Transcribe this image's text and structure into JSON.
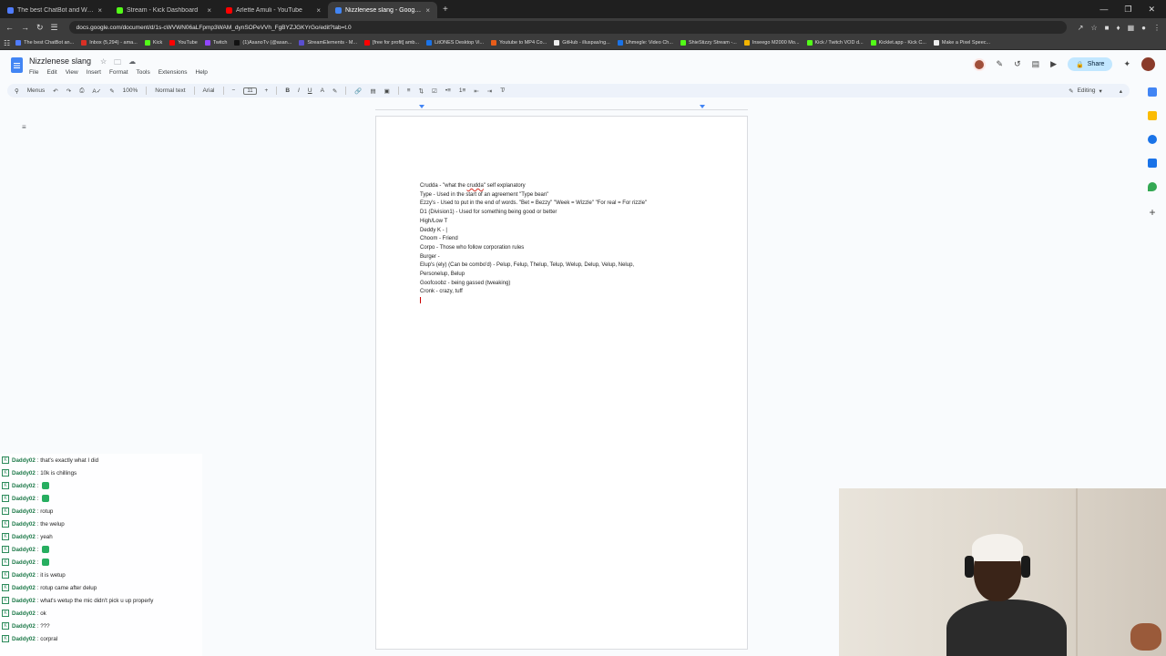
{
  "browser": {
    "tabs": [
      {
        "title": "The best ChatBot and Widgets for Ki",
        "color": "#4f7cff",
        "active": false
      },
      {
        "title": "Stream - Kick Dashboard",
        "color": "#53fc18",
        "active": false
      },
      {
        "title": "Arlette Amuli - YouTube",
        "color": "#ff0000",
        "active": false
      },
      {
        "title": "Nizzlenese slang - Google Docs",
        "color": "#4285f4",
        "active": true
      }
    ],
    "url": "docs.google.com/document/d/1s-cWVWN06aLFpmp3WAM_dynSOPeVVh_FgBYZJGKYrGo/edit?tab=t.0",
    "bookmarks": [
      {
        "label": "The best ChatBot an...",
        "color": "#4f7cff"
      },
      {
        "label": "Inbox (5,294) - ama...",
        "color": "#d93025"
      },
      {
        "label": "Kick",
        "color": "#53fc18"
      },
      {
        "label": "YouTube",
        "color": "#ff0000"
      },
      {
        "label": "Twitch",
        "color": "#9146ff"
      },
      {
        "label": "(1)AsanoTv (@asan...",
        "color": "#111111"
      },
      {
        "label": "StreamElements - M...",
        "color": "#5a4fcf"
      },
      {
        "label": "[free for profit] amb...",
        "color": "#ff0000"
      },
      {
        "label": "LitONES Desktop Vi...",
        "color": "#1a73e8"
      },
      {
        "label": "Youtube to MP4 Co...",
        "color": "#e85d1a"
      },
      {
        "label": "GitHub - illuspas/ng...",
        "color": "#eeeeee"
      },
      {
        "label": "Uhmegle: Video Ch...",
        "color": "#1a73e8"
      },
      {
        "label": "ShieStizzy Stream -...",
        "color": "#53fc18"
      },
      {
        "label": "Inseego M2000 Mo...",
        "color": "#f4b400"
      },
      {
        "label": "Kick / Twitch VOD d...",
        "color": "#53fc18"
      },
      {
        "label": "Kicklet.app - Kick C...",
        "color": "#53fc18"
      },
      {
        "label": "Make a Pixel Speec...",
        "color": "#eeeeee"
      }
    ]
  },
  "doc": {
    "title": "Nizzlenese slang",
    "menus": [
      "File",
      "Edit",
      "View",
      "Insert",
      "Format",
      "Tools",
      "Extensions",
      "Help"
    ],
    "share_label": "Share",
    "toolbar": {
      "menus_label": "Menus",
      "zoom": "100%",
      "style": "Normal text",
      "font": "Arial",
      "font_size": "11",
      "mode": "Editing"
    },
    "lines": [
      {
        "before": "Crudda - \"what the ",
        "squiggle": "crudda",
        "after": "\" self explanatory"
      },
      {
        "text": "Type - Used in the start of an agreement  \"Type bean\""
      },
      {
        "text": "Ezzy's - Used to put in the end of words. \"Bet = Bezzy\" \"Week = Wizzle\" \"For real = For rizzle\""
      },
      {
        "text": "D1 (Division1) - Used for something being good or better"
      },
      {
        "text": "High/Low T"
      },
      {
        "text": "Deddy K - |"
      },
      {
        "text": "Choom - Friend"
      },
      {
        "text": "Corpo - Those who follow corporation rules"
      },
      {
        "text": "Burger -"
      },
      {
        "text": "Elup's (ely) (Can be combo'd) - Pelup, Felup, Thelup, Telup, Welup, Delup, Velup, Nelup,"
      },
      {
        "text": "Personelup, Belup"
      },
      {
        "text": "Goofcoobz - being gassed (tweaking)"
      },
      {
        "text": "Cronk - crazy, tuff"
      }
    ]
  },
  "chat": {
    "messages": [
      {
        "user": "Daddy02",
        "msg": ": that's exactly what I did",
        "emote": false
      },
      {
        "user": "Daddy02",
        "msg": ": 10k is chillings",
        "emote": false
      },
      {
        "user": "Daddy02",
        "msg": ":",
        "emote": true
      },
      {
        "user": "Daddy02",
        "msg": ":",
        "emote": true
      },
      {
        "user": "Daddy02",
        "msg": ": rotup",
        "emote": false
      },
      {
        "user": "Daddy02",
        "msg": ": the welup",
        "emote": false
      },
      {
        "user": "Daddy02",
        "msg": ": yeah",
        "emote": false
      },
      {
        "user": "Daddy02",
        "msg": ":",
        "emote": true
      },
      {
        "user": "Daddy02",
        "msg": ":",
        "emote": true
      },
      {
        "user": "Daddy02",
        "msg": ": it is wetup",
        "emote": false
      },
      {
        "user": "Daddy02",
        "msg": ": rotup came after delup",
        "emote": false
      },
      {
        "user": "Daddy02",
        "msg": ": what's wetup the mic didn't pick u up properly",
        "emote": false
      },
      {
        "user": "Daddy02",
        "msg": ": ok",
        "emote": false
      },
      {
        "user": "Daddy02",
        "msg": ": ???",
        "emote": false
      },
      {
        "user": "Daddy02",
        "msg": ": corpral",
        "emote": false
      }
    ]
  }
}
